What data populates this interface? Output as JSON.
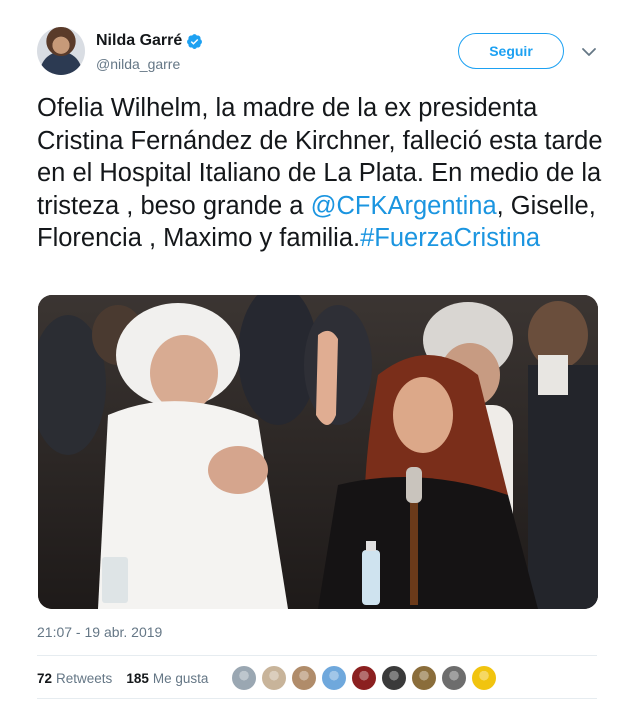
{
  "author": {
    "display_name": "Nilda Garré",
    "handle": "@nilda_garre",
    "verified": true,
    "avatar_icon": "profile-photo"
  },
  "actions": {
    "follow_label": "Seguir",
    "menu_icon": "chevron-down-icon"
  },
  "tweet": {
    "text_part1": "Ofelia Wilhelm, la madre de la ex presidenta Cristina Fernández de Kirchner, falleció esta tarde en el Hospital Italiano de La Plata. En medio de la tristeza , beso grande a ",
    "mention": "@CFKArgentina",
    "text_part2": ", Giselle, Florencia , Maximo y familia.",
    "hashtag": "#FuerzaCristina",
    "timestamp": "21:07 - 19 abr. 2019"
  },
  "stats": {
    "retweets_count": "72",
    "retweets_label": "Retweets",
    "likes_count": "185",
    "likes_label": "Me gusta"
  },
  "colors": {
    "accent": "#1da1f2",
    "link": "#1b95e0",
    "secondary_text": "#657786"
  },
  "liker_avatars": [
    "#9aa7b2",
    "#c8b49a",
    "#b08c6a",
    "#6fa8dc",
    "#8b2020",
    "#3a3a3a",
    "#8a6d3b",
    "#6d6d6d",
    "#f1c40f"
  ]
}
